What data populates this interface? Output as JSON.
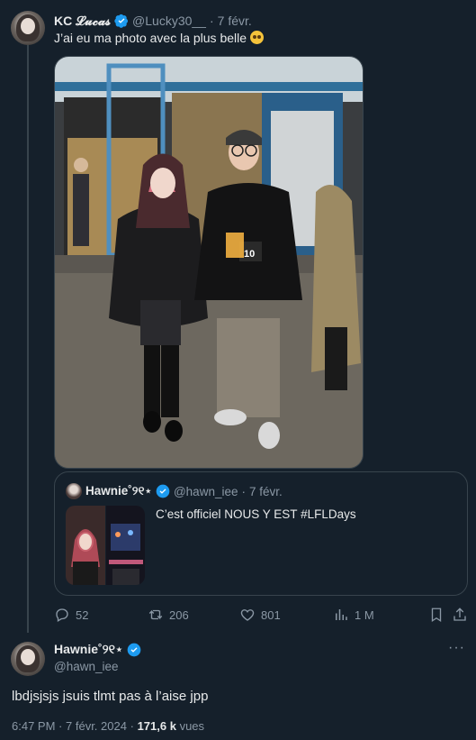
{
  "tweet1": {
    "display_name": "KC 𝓛𝓾𝓬𝓪𝓼",
    "handle": "@Lucky30__",
    "separator": "·",
    "date": "7 févr.",
    "text": "J’ai eu ma photo avec la plus belle",
    "emoji": "pleading-face-emoji",
    "quote": {
      "display_name": "Hawnie˚୨୧⋆",
      "handle": "@hawn_iee",
      "date": "7 févr.",
      "text": "C’est officiel NOUS Y EST #LFLDays"
    },
    "actions": {
      "replies": "52",
      "retweets": "206",
      "likes": "801",
      "views": "1 M"
    }
  },
  "tweet2": {
    "display_name": "Hawnie˚୨୧⋆",
    "handle": "@hawn_iee",
    "more": "···",
    "text": "lbdjsjsjs jsuis tlmt pas à l’aise jpp",
    "time": "6:47 PM",
    "date": "7 févr. 2024",
    "view_count": "171,6 k",
    "views_label": "vues"
  },
  "colors": {
    "background": "#15202b",
    "text": "#e7e9ea",
    "muted": "#8b98a5",
    "border": "#38444d",
    "verified": "#1d9bf0"
  }
}
